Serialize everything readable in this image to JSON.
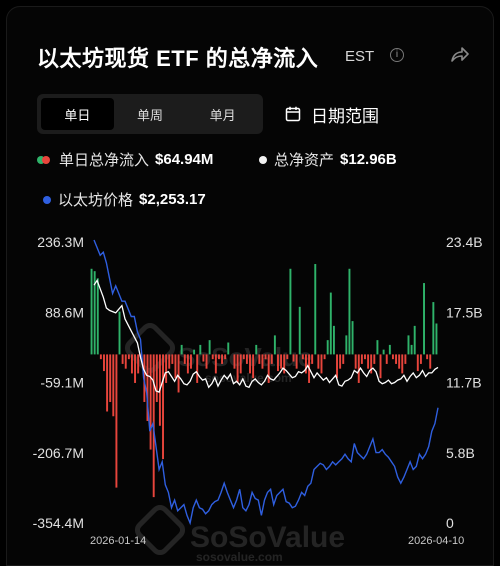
{
  "header": {
    "title": "以太坊现货 ETF 的总净流入",
    "timezone": "EST",
    "info_glyph": "i"
  },
  "tabs": [
    {
      "label": "单日",
      "active": true
    },
    {
      "label": "单周",
      "active": false
    },
    {
      "label": "单月",
      "active": false
    }
  ],
  "date_range_label": "日期范围",
  "legend": {
    "daily_net_inflow": {
      "label": "单日总净流入",
      "value": "$64.94M"
    },
    "total_net_assets": {
      "label": "总净资产",
      "value": "$12.96B"
    },
    "eth_price": {
      "label": "以太坊价格",
      "value": "$2,253.17"
    }
  },
  "watermark": {
    "brand": "SoSoValue",
    "url": "sosovalue.com"
  },
  "colors": {
    "inflow": "#2fb36a",
    "outflow": "#e8453c",
    "net_assets_line": "#ffffff",
    "price_line": "#2f5fe0",
    "background": "#050505"
  },
  "icons": [
    "info-icon",
    "share-icon",
    "calendar-icon"
  ],
  "chart_data": {
    "type": "bar",
    "x_start_label": "2026-01-14",
    "x_end_label": "2026-04-10",
    "left_axis": {
      "ticks": [
        "236.3M",
        "88.6M",
        "-59.1M",
        "-206.7M",
        "-354.4M"
      ],
      "ylim": [
        -354.4,
        236.3
      ],
      "unit": "M"
    },
    "right_axis": {
      "ticks": [
        "23.4B",
        "17.5B",
        "11.7B",
        "5.8B",
        "0"
      ],
      "ylim": [
        0,
        23.4
      ],
      "unit": "B"
    },
    "series": [
      {
        "name": "单日总净流入",
        "type": "bar",
        "axis": "left",
        "values": [
          180,
          175,
          160,
          -10,
          -35,
          -120,
          -100,
          -130,
          -280,
          90,
          -20,
          -30,
          -10,
          -40,
          -60,
          -40,
          -10,
          -100,
          -140,
          -200,
          -300,
          -100,
          -150,
          -220,
          -60,
          -30,
          -20,
          -50,
          -80,
          20,
          -20,
          -40,
          -30,
          10,
          -60,
          20,
          -15,
          -30,
          30,
          -10,
          -40,
          -10,
          -20,
          -10,
          25,
          0,
          -30,
          -60,
          -40,
          -10,
          -20,
          -40,
          -50,
          20,
          -20,
          -30,
          -10,
          -60,
          -20,
          40,
          -35,
          -30,
          -40,
          -10,
          180,
          -15,
          -30,
          100,
          -10,
          -40,
          -60,
          -20,
          190,
          -30,
          -40,
          -10,
          30,
          130,
          60,
          -50,
          -30,
          -20,
          40,
          180,
          70,
          -30,
          -60,
          -20,
          -10,
          -30,
          -40,
          -20,
          30,
          -50,
          10,
          -20,
          20,
          -10,
          -20,
          -30,
          -40,
          -20,
          40,
          20,
          60,
          -35,
          -20,
          150,
          -10,
          -30,
          110,
          65
        ]
      },
      {
        "name": "总净资产",
        "type": "line",
        "axis": "right",
        "values": [
          19.8,
          20.2,
          19.5,
          18.8,
          17.9,
          17.7,
          17.6,
          17.5,
          17.8,
          18.1,
          17.0,
          16.5,
          16.0,
          15.5,
          15.0,
          13.8,
          12.8,
          12.3,
          12.2,
          11.9,
          11.0,
          10.9,
          11.7,
          12.5,
          12.6,
          12.2,
          11.8,
          12.3,
          12.0,
          11.6,
          11.5,
          11.8,
          12.4,
          12.6,
          12.2,
          11.9,
          12.0,
          11.3,
          11.6,
          12.1,
          11.4,
          11.9,
          12.3,
          12.0,
          12.4,
          11.6,
          11.8,
          11.5,
          12.0,
          11.4,
          11.3,
          11.8,
          12.0,
          11.7,
          11.5,
          11.8,
          12.3,
          12.0,
          11.9,
          12.2,
          12.5,
          12.9,
          12.7,
          12.4,
          12.1,
          12.2,
          12.6,
          12.5,
          12.7,
          13.1,
          12.6,
          12.1,
          12.5,
          12.2,
          11.9,
          12.1,
          11.7,
          12.0,
          12.3,
          11.5,
          11.4,
          11.8,
          11.9,
          12.1,
          12.7,
          12.5,
          12.9,
          12.5,
          12.2,
          12.7,
          12.9,
          12.6,
          11.8,
          11.6,
          11.7,
          11.9,
          11.6,
          11.7,
          11.9,
          12.0,
          12.3,
          11.8,
          12.2,
          12.5,
          12.1,
          12.3,
          12.7,
          12.2,
          12.5,
          12.5,
          12.8,
          12.96
        ]
      },
      {
        "name": "以太坊价格",
        "type": "line",
        "axis": "none",
        "values": [
          3350,
          3300,
          3250,
          3270,
          3200,
          3100,
          3000,
          3050,
          3000,
          2950,
          2950,
          2900,
          2850,
          2850,
          2750,
          2700,
          2450,
          2350,
          2100,
          2150,
          2000,
          1850,
          1900,
          1750,
          1700,
          1600,
          1650,
          1580,
          1600,
          1620,
          1550,
          1500,
          1600,
          1650,
          1600,
          1590,
          1560,
          1580,
          1620,
          1640,
          1650,
          1700,
          1760,
          1700,
          1650,
          1600,
          1650,
          1720,
          1600,
          1580,
          1620,
          1700,
          1660,
          1650,
          1550,
          1650,
          1700,
          1720,
          1620,
          1680,
          1700,
          1720,
          1640,
          1630,
          1600,
          1610,
          1650,
          1700,
          1680,
          1740,
          1760,
          1850,
          1870,
          1890,
          1880,
          1850,
          1870,
          1900,
          1880,
          1900,
          1920,
          1950,
          1920,
          1900,
          2020,
          1960,
          1940,
          1920,
          1950,
          2000,
          2050,
          1960,
          1960,
          1980,
          1950,
          1930,
          1900,
          1870,
          1800,
          1760,
          1800,
          1850,
          1900,
          1850,
          1870,
          1950,
          1920,
          1950,
          2000,
          2100,
          2150,
          2253.17
        ]
      }
    ]
  }
}
